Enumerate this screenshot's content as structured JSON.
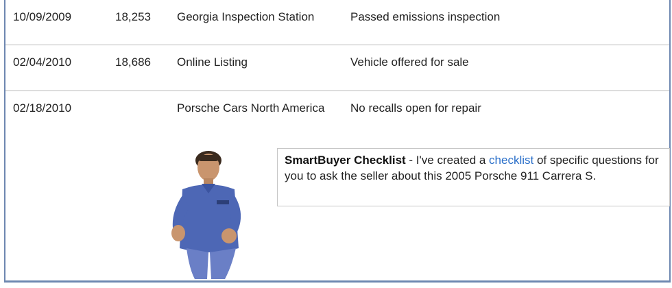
{
  "history": {
    "rows": [
      {
        "date": "10/09/2009",
        "odometer": "18,253",
        "source": "Georgia Inspection Station",
        "comment": "Passed emissions inspection"
      },
      {
        "date": "02/04/2010",
        "odometer": "18,686",
        "source": "Online Listing",
        "comment": "Vehicle offered for sale"
      },
      {
        "date": "02/18/2010",
        "odometer": "",
        "source": "Porsche Cars North America",
        "comment": "No recalls open for repair"
      }
    ]
  },
  "smartbuyer": {
    "title": "SmartBuyer Checklist",
    "text_before": " - I've created a ",
    "link": "checklist",
    "text_after": " of specific questions for you to ask the seller about this 2005 Porsche 911 Carrera S.",
    "avatar_icon": "spokesperson-illustration",
    "link_color": "#2a6fc9"
  }
}
